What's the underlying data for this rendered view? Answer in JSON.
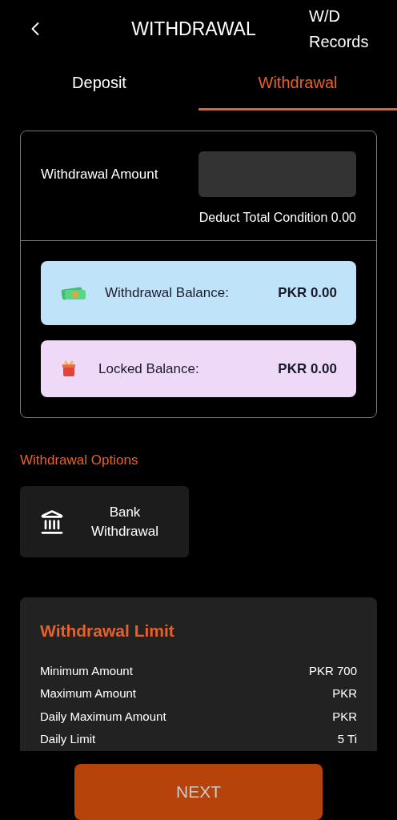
{
  "header": {
    "title": "WITHDRAWAL",
    "records_link": "W/D Records"
  },
  "tabs": [
    {
      "label": "Deposit",
      "selected": false
    },
    {
      "label": "Withdrawal",
      "selected": true
    }
  ],
  "amount": {
    "label": "Withdrawal Amount",
    "condition": "Deduct Total Condition 0.00"
  },
  "balances": [
    {
      "kind": "cash",
      "label": "Withdrawal Balance:",
      "value": "PKR 0.00",
      "color": "#bfe3f8"
    },
    {
      "kind": "gift",
      "label": "Locked Balance:",
      "value": "PKR 0.00",
      "color": "#efd9f8"
    }
  ],
  "options": {
    "title": "Withdrawal Options",
    "items": [
      {
        "label": "Bank Withdrawal"
      }
    ]
  },
  "limit": {
    "title": "Withdrawal Limit",
    "rows": [
      {
        "label": "Minimum Amount",
        "value": "PKR 700"
      },
      {
        "label": "Maximum Amount",
        "value": "PKR"
      },
      {
        "label": "Daily Maximum Amount",
        "value": "PKR"
      },
      {
        "label": "Daily Limit",
        "value": "5 Ti"
      }
    ]
  },
  "next_button": "NEXT"
}
